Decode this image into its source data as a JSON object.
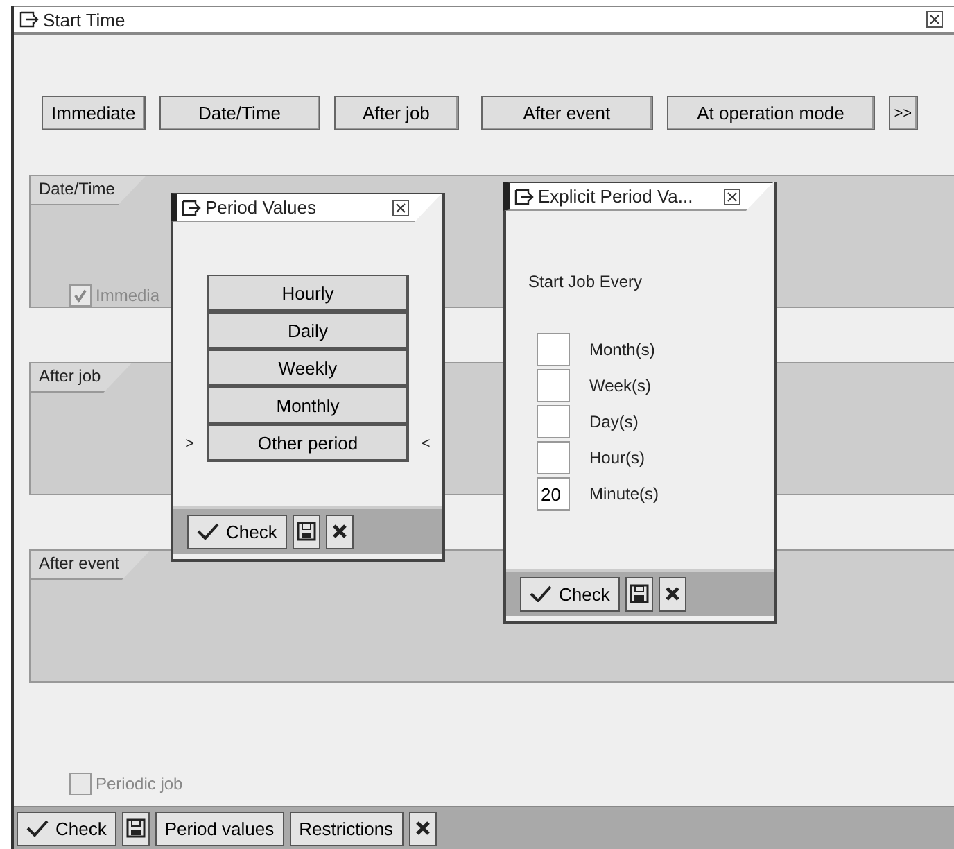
{
  "window": {
    "title": "Start Time"
  },
  "start_buttons": [
    "Immediate",
    "Date/Time",
    "After job",
    "After event",
    "At operation mode",
    ">>"
  ],
  "groups": [
    {
      "title": "Date/Time",
      "checkbox": {
        "label": "Immedia",
        "checked": true,
        "disabled": true
      }
    },
    {
      "title": "After job"
    },
    {
      "title": "After event"
    }
  ],
  "periodic_job": {
    "label": "Periodic job",
    "checked": false,
    "disabled": true
  },
  "toolbar": [
    {
      "kind": "check",
      "label": "Check"
    },
    {
      "kind": "save"
    },
    {
      "kind": "text",
      "label": "Period values"
    },
    {
      "kind": "text",
      "label": "Restrictions"
    },
    {
      "kind": "cancel"
    }
  ],
  "period_values_dialog": {
    "title": "Period Values",
    "options": [
      {
        "label": "Hourly"
      },
      {
        "label": "Daily"
      },
      {
        "label": "Weekly"
      },
      {
        "label": "Monthly"
      },
      {
        "label": "Other period",
        "marker_left": ">",
        "marker_right": "<"
      }
    ],
    "check_label": "Check"
  },
  "explicit_dialog": {
    "title": "Explicit Period Va...",
    "heading": "Start Job Every",
    "fields": [
      {
        "label": "Month(s)"
      },
      {
        "label": "Week(s)"
      },
      {
        "label": "Day(s)"
      },
      {
        "label": "Hour(s)"
      },
      {
        "label": "Minute(s)",
        "value": "20"
      }
    ],
    "check_label": "Check"
  }
}
